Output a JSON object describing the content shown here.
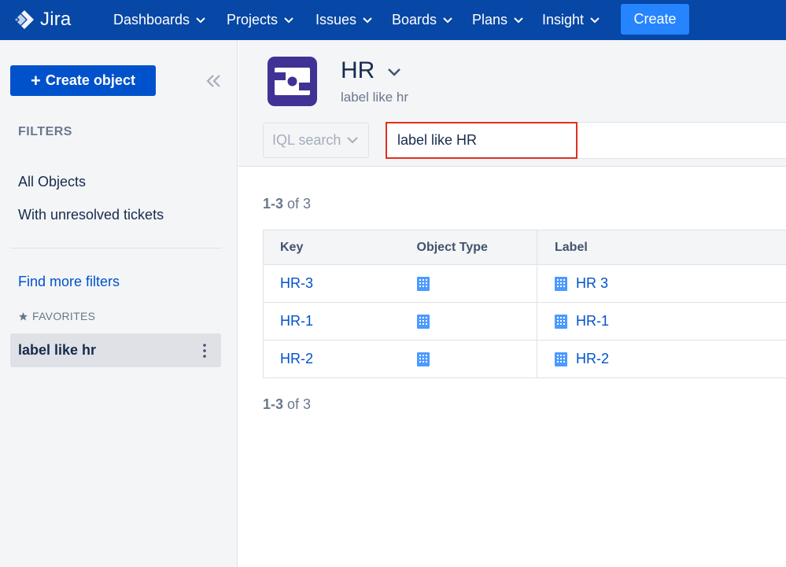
{
  "topnav": {
    "brand": "Jira",
    "items": [
      {
        "label": "Dashboards"
      },
      {
        "label": "Projects"
      },
      {
        "label": "Issues"
      },
      {
        "label": "Boards"
      },
      {
        "label": "Plans"
      },
      {
        "label": "Insight"
      }
    ],
    "create_label": "Create"
  },
  "sidebar": {
    "create_object_label": "Create object",
    "filters_heading": "FILTERS",
    "links": [
      {
        "label": "All Objects"
      },
      {
        "label": "With unresolved tickets"
      }
    ],
    "find_more_filters": "Find more filters",
    "favorites_heading": "FAVORITES",
    "favorite_items": [
      {
        "label": "label like hr"
      }
    ]
  },
  "header": {
    "title": "HR",
    "subtitle": "label like hr",
    "search_mode": "IQL search",
    "query_value": "label like HR"
  },
  "results": {
    "range_bold": "1-3",
    "range_rest": "of 3",
    "columns": [
      "Key",
      "Object Type",
      "Label"
    ],
    "rows": [
      {
        "key": "HR-3",
        "object_type_icon": "building-icon",
        "label": "HR 3"
      },
      {
        "key": "HR-1",
        "object_type_icon": "building-icon",
        "label": "HR-1"
      },
      {
        "key": "HR-2",
        "object_type_icon": "building-icon",
        "label": "HR-2"
      }
    ]
  },
  "colors": {
    "nav_bg": "#0747a6",
    "create_btn": "#2684ff",
    "primary_btn": "#0052cc",
    "link": "#0052cc",
    "highlight_border": "#e0301e",
    "schema_icon": "#403294",
    "object_type_icon": "#4c9aff"
  }
}
